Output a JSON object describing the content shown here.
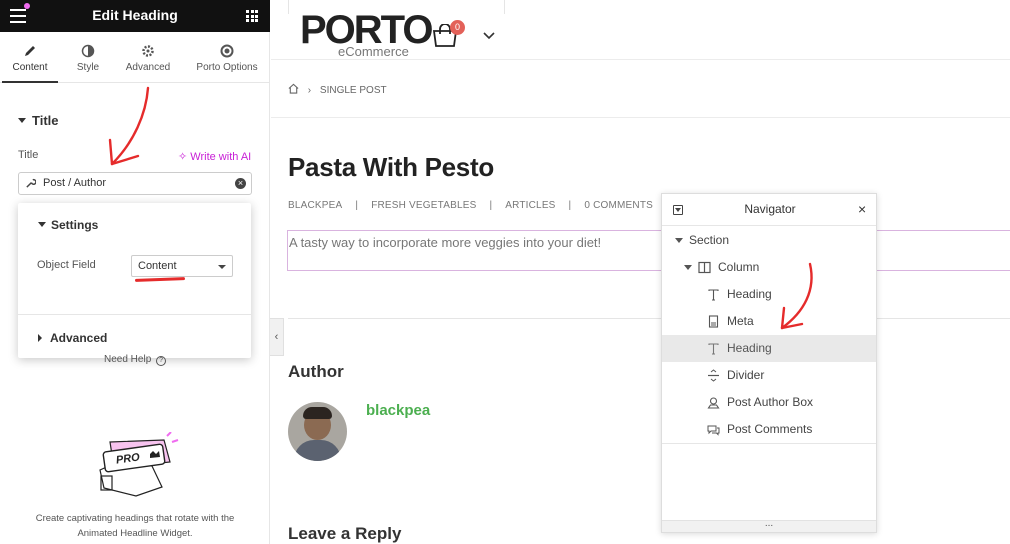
{
  "panel": {
    "title": "Edit Heading",
    "tabs": [
      {
        "label": "Content",
        "icon": "pencil-icon"
      },
      {
        "label": "Style",
        "icon": "contrast-icon"
      },
      {
        "label": "Advanced",
        "icon": "gear-icon"
      },
      {
        "label": "Porto Options",
        "icon": "circle-dot-icon"
      }
    ],
    "section_title": "Title",
    "field_label": "Title",
    "ai_link": "Write with AI",
    "input_value": "Post / Author",
    "popup": {
      "settings_title": "Settings",
      "object_field_label": "Object Field",
      "object_field_value": "Content",
      "advanced_title": "Advanced"
    },
    "need_help": "Need Help",
    "pro_badge": "PRO",
    "promo_text_line1": "Create captivating headings that rotate with the",
    "promo_text_line2": "Animated Headline Widget."
  },
  "header": {
    "logo_word": "PORTO",
    "logo_sub": "eCommerce",
    "cart_count": "0"
  },
  "breadcrumb": {
    "current": "SINGLE POST"
  },
  "post": {
    "title": "Pasta With Pesto",
    "meta": [
      "BLACKPEA",
      "FRESH VEGETABLES",
      "ARTICLES",
      "0 COMMENTS"
    ],
    "separator": "|",
    "excerpt": "A tasty way to incorporate more veggies into your diet!",
    "author_heading": "Author",
    "author_name": "blackpea",
    "reply_heading": "Leave a Reply"
  },
  "navigator": {
    "title": "Navigator",
    "items": [
      {
        "label": "Section",
        "icon": "caret-down-icon"
      },
      {
        "label": "Column",
        "icon": "column-icon"
      },
      {
        "label": "Heading",
        "icon": "text-icon"
      },
      {
        "label": "Meta",
        "icon": "meta-icon"
      },
      {
        "label": "Heading",
        "icon": "text-icon",
        "selected": true
      },
      {
        "label": "Divider",
        "icon": "divider-icon"
      },
      {
        "label": "Post Author Box",
        "icon": "author-box-icon"
      },
      {
        "label": "Post Comments",
        "icon": "comments-icon"
      }
    ],
    "footer": "..."
  },
  "colors": {
    "accent": "#c81fd6",
    "author_green": "#4caf50",
    "annotation_red": "#e52b2b",
    "badge": "#e36159"
  }
}
